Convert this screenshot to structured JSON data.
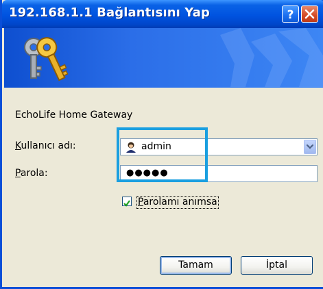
{
  "window": {
    "title": "192.168.1.1 Bağlantısını Yap",
    "buttons": {
      "help_icon": "help-icon",
      "close_icon": "close-icon"
    }
  },
  "dialog": {
    "realm": "EchoLife Home Gateway",
    "username": {
      "label_accel": "K",
      "label_rest": "ullanıcı adı:",
      "value": "admin",
      "icon": "user-icon"
    },
    "password": {
      "label_accel": "P",
      "label_rest": "arola:",
      "value": "●●●●●"
    },
    "remember": {
      "checked": true,
      "label_accel": "P",
      "label_rest": "arolamı anımsa"
    },
    "ok_label": "Tamam",
    "cancel_label": "İptal"
  },
  "colors": {
    "titlebar": "#0053e0",
    "banner": "#2b6ee8",
    "highlight": "#1a9fe0",
    "dialog_bg": "#ece9d8"
  }
}
